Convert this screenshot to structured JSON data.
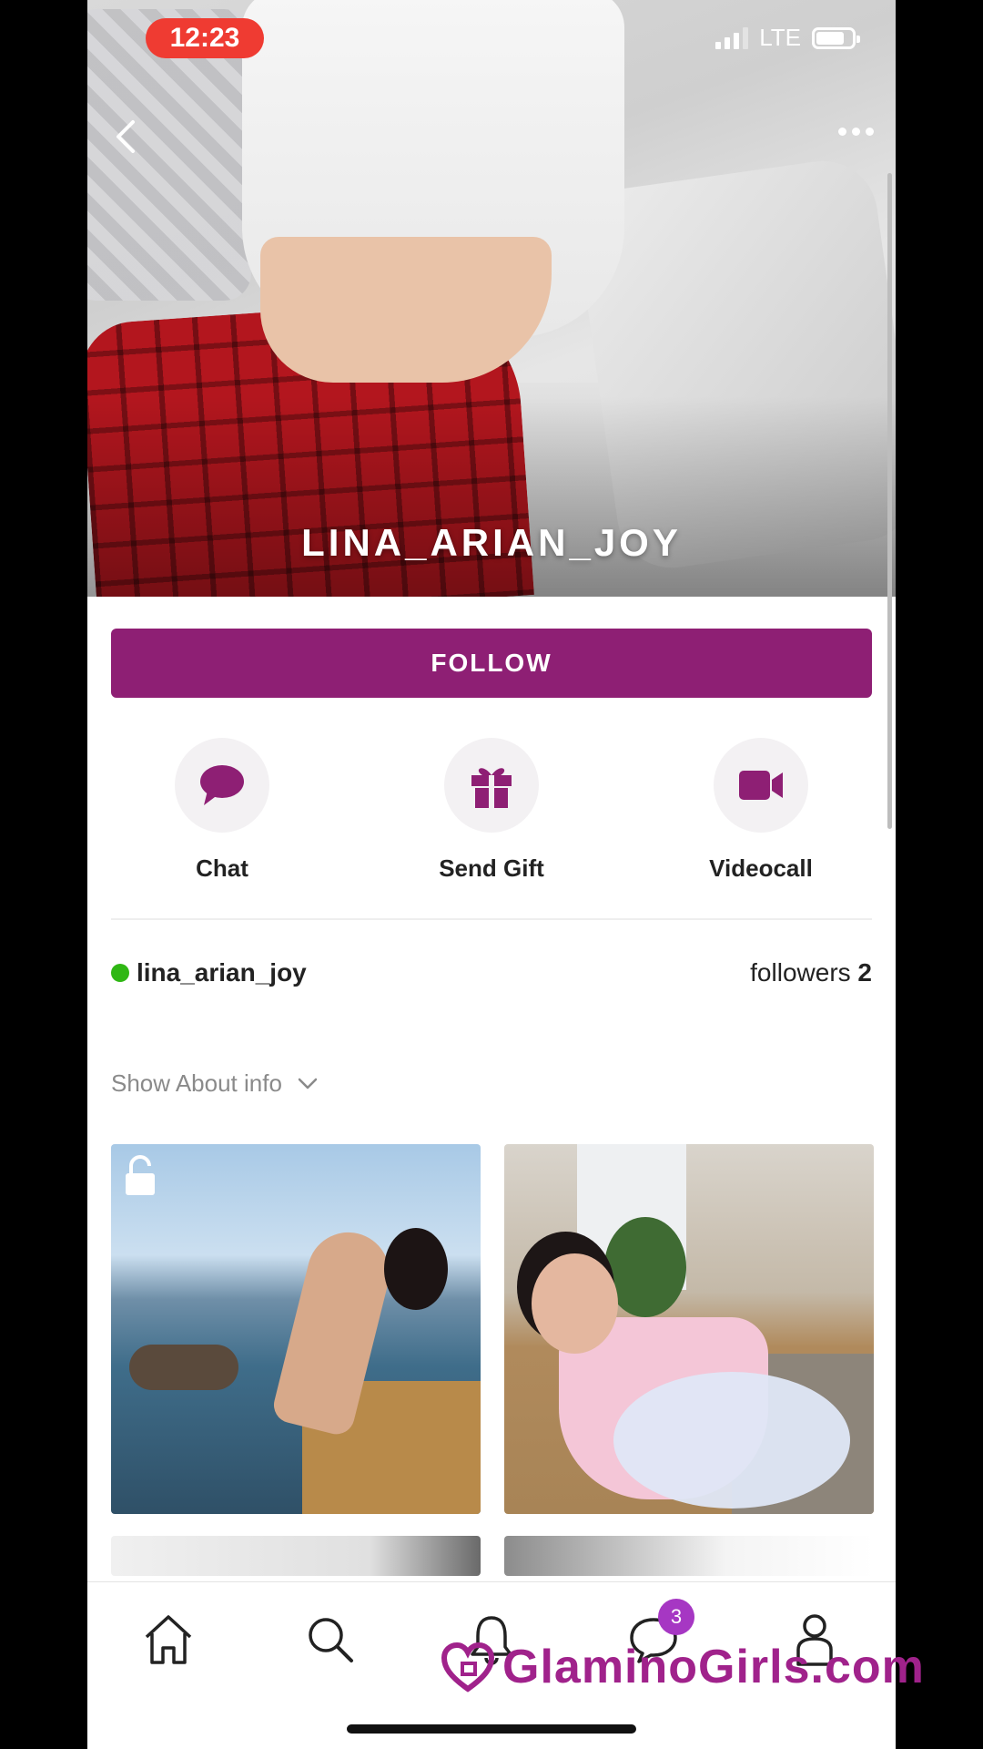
{
  "status_bar": {
    "time": "12:23",
    "network": "LTE"
  },
  "hero": {
    "name": "LINA_ARIAN_JOY"
  },
  "follow_button": {
    "label": "FOLLOW"
  },
  "actions": [
    {
      "label": "Chat",
      "icon": "chat-bubble-icon"
    },
    {
      "label": "Send Gift",
      "icon": "gift-icon"
    },
    {
      "label": "Videocall",
      "icon": "video-camera-icon"
    }
  ],
  "user": {
    "username": "lina_arian_joy",
    "online": true,
    "followers_label": "followers",
    "followers_count": "2"
  },
  "about": {
    "label": "Show About info"
  },
  "tabbar": {
    "items": [
      "home-icon",
      "search-icon",
      "bell-icon",
      "messages-icon",
      "profile-icon"
    ],
    "messages_badge": "3"
  },
  "watermark": {
    "text": "GlaminoGirls.com"
  },
  "colors": {
    "accent": "#8e1f74",
    "online": "#2fb714",
    "time_pill": "#ef3b32",
    "badge": "#a637c3"
  }
}
